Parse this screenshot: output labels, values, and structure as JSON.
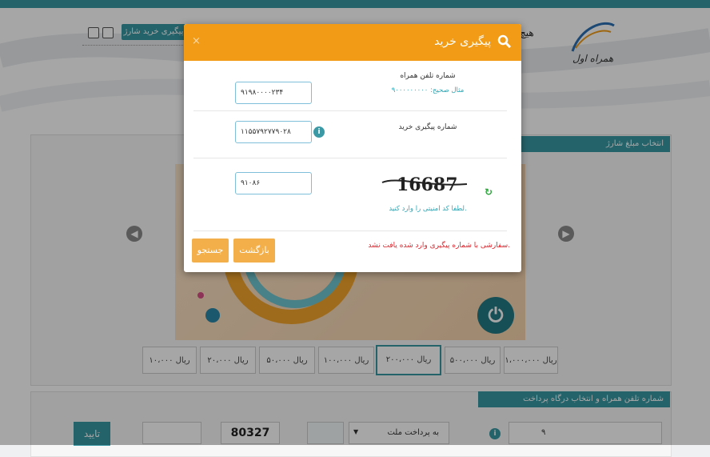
{
  "header": {
    "nav_charge_label": "پیگیری خرید شارژ",
    "hero_text": "هیچ",
    "brand": "همراه اول"
  },
  "amounts_section": {
    "title": "انتخاب مبلغ شارژ",
    "options": [
      {
        "label": "۱۰،۰۰۰ ریال",
        "selected": false
      },
      {
        "label": "۲۰،۰۰۰ ریال",
        "selected": false
      },
      {
        "label": "۵۰،۰۰۰ ریال",
        "selected": false
      },
      {
        "label": "۱۰۰،۰۰۰ ریال",
        "selected": false
      },
      {
        "label": "۲۰۰،۰۰۰ ریال",
        "selected": true
      },
      {
        "label": "۵۰۰،۰۰۰ ریال",
        "selected": false
      },
      {
        "label": "۱،۰۰۰،۰۰۰ ریال",
        "selected": false
      }
    ]
  },
  "payment_section": {
    "title": "شماره تلفن همراه و انتخاب درگاه پرداخت",
    "phone_value": "۹",
    "gateway_value": "به پرداخت ملت",
    "captcha_text": "80327",
    "confirm_label": "تایید"
  },
  "modal": {
    "title": "پیگیری خرید",
    "close_symbol": "×",
    "phone_label": "شماره تلفن همراه",
    "phone_hint": "مثال صحیح: ۹۰۰۰۰۰۰۰۰۰",
    "phone_value": "۹۱۹۸۰۰۰۰۲۳۴",
    "tracking_label": "شماره پیگیری خرید",
    "tracking_value": "۱۱۵۵۷۹۲۷۷۹۰۲۸",
    "captcha_text": "16687",
    "captcha_hint": "لطفا کد امنیتی را وارد کنید.",
    "captcha_value": "۹۱۰۸۶",
    "error_message": "سفارشی با شماره پیگیری وارد شده یافت نشد.",
    "back_label": "بازگشت",
    "search_label": "جستجو"
  },
  "colors": {
    "accent": "#3a99a4",
    "modal_header": "#f19b16",
    "button": "#f3b04a",
    "error": "#d9262d"
  }
}
